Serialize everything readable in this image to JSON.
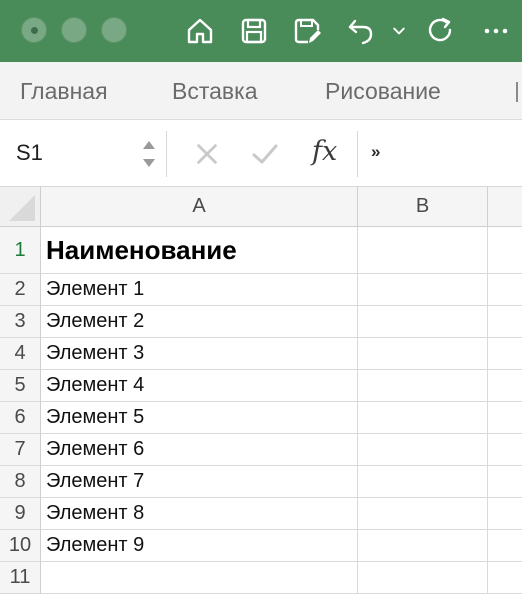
{
  "titlebar": {
    "color": "#4a8b5a",
    "icons": [
      "home-icon",
      "save-icon",
      "save-edit-icon",
      "undo-icon",
      "chevron-down-icon",
      "redo-icon",
      "more-icon"
    ]
  },
  "ribbon": {
    "tabs": [
      "Главная",
      "Вставка",
      "Рисование"
    ]
  },
  "formula_bar": {
    "name_box": "S1",
    "fx_label": "fx",
    "more_label": "»",
    "formula_value": ""
  },
  "sheet": {
    "columns": [
      "A",
      "B"
    ],
    "rows": [
      {
        "num": "1",
        "a": "Наименование",
        "b": ""
      },
      {
        "num": "2",
        "a": "Элемент 1",
        "b": ""
      },
      {
        "num": "3",
        "a": "Элемент 2",
        "b": ""
      },
      {
        "num": "4",
        "a": "Элемент 3",
        "b": ""
      },
      {
        "num": "5",
        "a": "Элемент 4",
        "b": ""
      },
      {
        "num": "6",
        "a": "Элемент 5",
        "b": ""
      },
      {
        "num": "7",
        "a": "Элемент 6",
        "b": ""
      },
      {
        "num": "8",
        "a": "Элемент 7",
        "b": ""
      },
      {
        "num": "9",
        "a": "Элемент 8",
        "b": ""
      },
      {
        "num": "10",
        "a": "Элемент 9",
        "b": ""
      },
      {
        "num": "11",
        "a": "",
        "b": ""
      }
    ]
  }
}
